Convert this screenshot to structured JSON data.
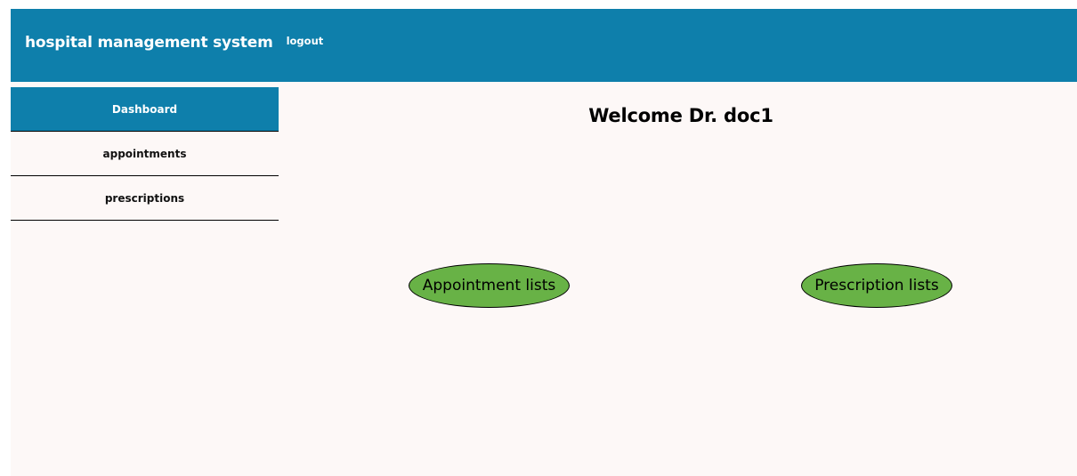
{
  "header": {
    "title": "hospital management system",
    "logout_label": "logout"
  },
  "sidebar": {
    "items": [
      {
        "label": "Dashboard",
        "active": true
      },
      {
        "label": "appointments",
        "active": false
      },
      {
        "label": "prescriptions",
        "active": false
      }
    ]
  },
  "main": {
    "welcome": "Welcome Dr. doc1",
    "buttons": {
      "appointments": "Appointment lists",
      "prescriptions": "Prescription lists"
    }
  },
  "colors": {
    "header_bg": "#0e7fab",
    "page_bg": "#fdf8f7",
    "button_green": "#68b246"
  }
}
